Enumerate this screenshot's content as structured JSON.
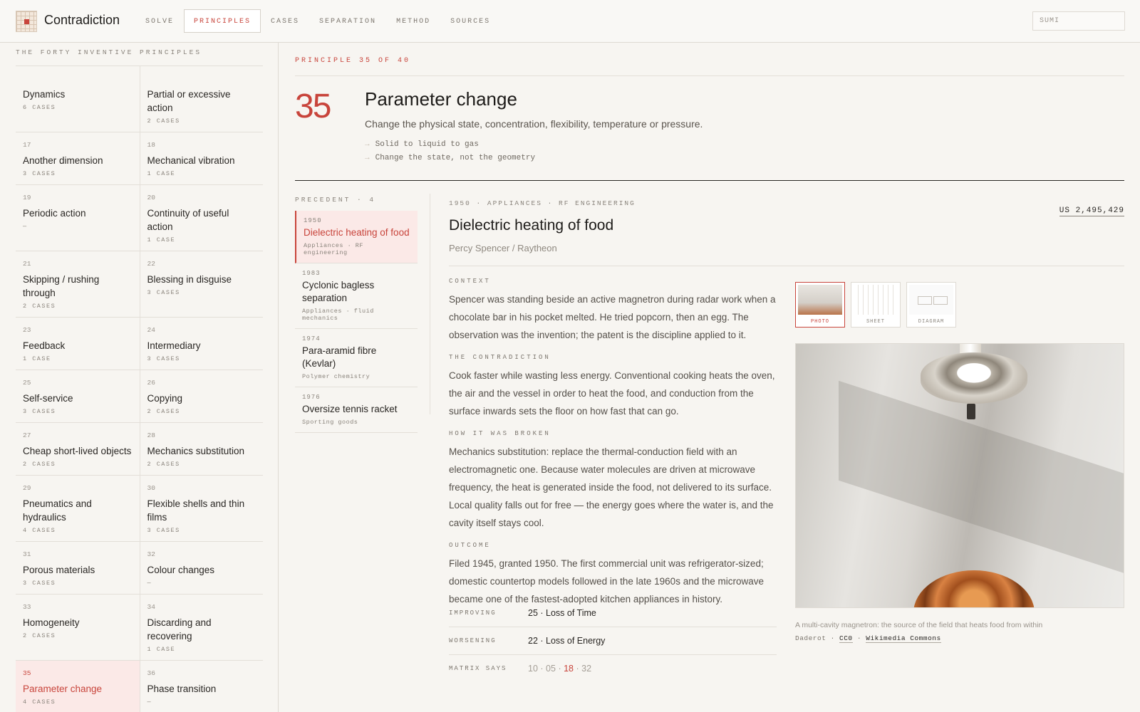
{
  "header": {
    "brand": "Contradiction",
    "nav": [
      "SOLVE",
      "PRINCIPLES",
      "CASES",
      "SEPARATION",
      "METHOD",
      "SOURCES"
    ],
    "active_nav": "PRINCIPLES",
    "search_value": "SUMI"
  },
  "sidebar": {
    "title": "THE FORTY INVENTIVE PRINCIPLES",
    "rows": [
      [
        {
          "num": "",
          "name": "Dynamics",
          "cases": "6 CASES"
        },
        {
          "num": "",
          "name": "Partial or excessive action",
          "cases": "2 CASES"
        }
      ],
      [
        {
          "num": "17",
          "name": "Another dimension",
          "cases": "3 CASES"
        },
        {
          "num": "18",
          "name": "Mechanical vibration",
          "cases": "1 CASE"
        }
      ],
      [
        {
          "num": "19",
          "name": "Periodic action",
          "cases": "—"
        },
        {
          "num": "20",
          "name": "Continuity of useful action",
          "cases": "1 CASE"
        }
      ],
      [
        {
          "num": "21",
          "name": "Skipping / rushing through",
          "cases": "2 CASES"
        },
        {
          "num": "22",
          "name": "Blessing in disguise",
          "cases": "3 CASES"
        }
      ],
      [
        {
          "num": "23",
          "name": "Feedback",
          "cases": "1 CASE"
        },
        {
          "num": "24",
          "name": "Intermediary",
          "cases": "3 CASES"
        }
      ],
      [
        {
          "num": "25",
          "name": "Self-service",
          "cases": "3 CASES"
        },
        {
          "num": "26",
          "name": "Copying",
          "cases": "2 CASES"
        }
      ],
      [
        {
          "num": "27",
          "name": "Cheap short-lived objects",
          "cases": "2 CASES"
        },
        {
          "num": "28",
          "name": "Mechanics substitution",
          "cases": "2 CASES"
        }
      ],
      [
        {
          "num": "29",
          "name": "Pneumatics and hydraulics",
          "cases": "4 CASES"
        },
        {
          "num": "30",
          "name": "Flexible shells and thin films",
          "cases": "3 CASES"
        }
      ],
      [
        {
          "num": "31",
          "name": "Porous materials",
          "cases": "3 CASES"
        },
        {
          "num": "32",
          "name": "Colour changes",
          "cases": "—"
        }
      ],
      [
        {
          "num": "33",
          "name": "Homogeneity",
          "cases": "2 CASES"
        },
        {
          "num": "34",
          "name": "Discarding and recovering",
          "cases": "1 CASE"
        }
      ],
      [
        {
          "num": "35",
          "name": "Parameter change",
          "cases": "4 CASES",
          "active": true
        },
        {
          "num": "36",
          "name": "Phase transition",
          "cases": "—"
        }
      ]
    ]
  },
  "principle": {
    "eyebrow": "PRINCIPLE 35 OF 40",
    "number": "35",
    "title": "Parameter change",
    "description": "Change the physical state, concentration, flexibility, temperature or pressure.",
    "bullets": [
      "Solid to liquid to gas",
      "Change the state, not the geometry"
    ]
  },
  "precedents": {
    "label": "PRECEDENT · 4",
    "items": [
      {
        "year": "1950",
        "title": "Dielectric heating of food",
        "field": "Appliances · RF engineering",
        "active": true
      },
      {
        "year": "1983",
        "title": "Cyclonic bagless separation",
        "field": "Appliances · fluid mechanics"
      },
      {
        "year": "1974",
        "title": "Para-aramid fibre (Kevlar)",
        "field": "Polymer chemistry"
      },
      {
        "year": "1976",
        "title": "Oversize tennis racket",
        "field": "Sporting goods"
      }
    ]
  },
  "case": {
    "meta": "1950 · APPLIANCES · RF ENGINEERING",
    "patent": "US 2,495,429",
    "title": "Dielectric heating of food",
    "byline": "Percy Spencer / Raytheon",
    "context_label": "CONTEXT",
    "context": "Spencer was standing beside an active magnetron during radar work when a chocolate bar in his pocket melted. He tried popcorn, then an egg. The observation was the invention; the patent is the discipline applied to it.",
    "contradiction_label": "THE CONTRADICTION",
    "contradiction": "Cook faster while wasting less energy. Conventional cooking heats the oven, the air and the vessel in order to heat the food, and conduction from the surface inwards sets the floor on how fast that can go.",
    "broken_label": "HOW IT WAS BROKEN",
    "broken": "Mechanics substitution: replace the thermal-conduction field with an electromagnetic one. Because water molecules are driven at microwave frequency, the heat is generated inside the food, not delivered to its surface. Local quality falls out for free — the energy goes where the water is, and the cavity itself stays cool.",
    "outcome_label": "OUTCOME",
    "outcome": "Filed 1945, granted 1950. The first commercial unit was refrigerator-sized; domestic countertop models followed in the late 1960s and the microwave became one of the fastest-adopted kitchen appliances in history.",
    "improving_label": "IMPROVING",
    "improving": "25 · Loss of Time",
    "worsening_label": "WORSENING",
    "worsening": "22 · Loss of Energy",
    "matrix_label": "MATRIX SAYS",
    "matrix": [
      "10",
      "05",
      "18",
      "32"
    ],
    "matrix_sep": "·",
    "tabs": [
      "PHOTO",
      "SHEET",
      "DIAGRAM"
    ],
    "caption": "A multi-cavity magnetron: the source of the field that heats food from within",
    "credit_author": "Daderot",
    "credit_license": "CC0",
    "credit_source": "Wikimedia Commons",
    "credit_sep": "·"
  },
  "colors": {
    "accent": "#c8443b",
    "background": "#f7f5f1",
    "active_bg": "#fbe9e7"
  }
}
